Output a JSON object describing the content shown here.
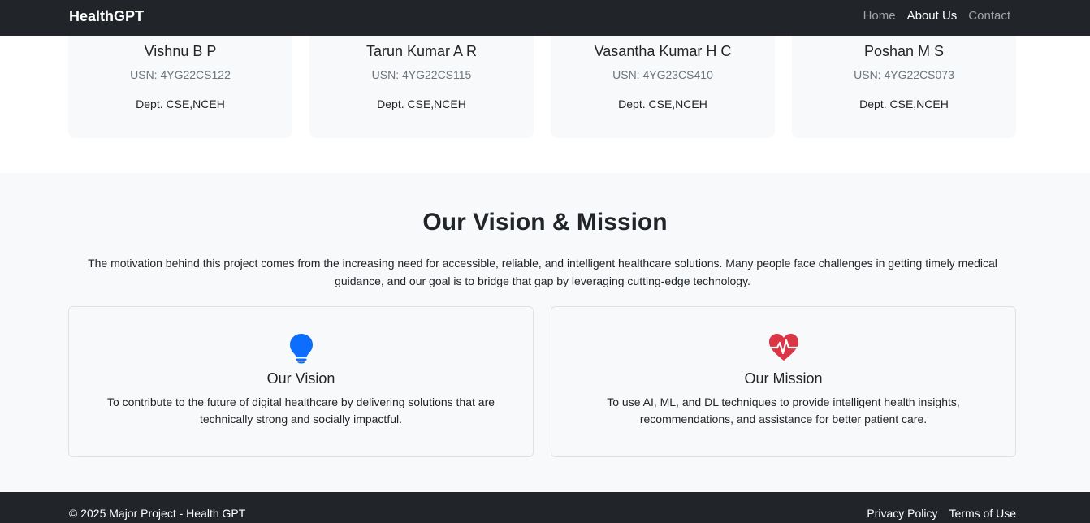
{
  "navbar": {
    "brand": "HealthGPT",
    "links": [
      "Home",
      "About Us",
      "Contact"
    ]
  },
  "team": [
    {
      "name": "Vishnu B P",
      "usn": "USN: 4YG22CS122",
      "dept": "Dept. CSE,NCEH"
    },
    {
      "name": "Tarun Kumar A R",
      "usn": "USN: 4YG22CS115",
      "dept": "Dept. CSE,NCEH"
    },
    {
      "name": "Vasantha Kumar H C",
      "usn": "USN: 4YG23CS410",
      "dept": "Dept. CSE,NCEH"
    },
    {
      "name": "Poshan M S",
      "usn": "USN: 4YG22CS073",
      "dept": "Dept. CSE,NCEH"
    }
  ],
  "vision_section": {
    "title": "Our Vision & Mission",
    "text": "The motivation behind this project comes from the increasing need for accessible, reliable, and intelligent healthcare solutions. Many people face challenges in getting timely medical guidance, and our goal is to bridge that gap by leveraging cutting-edge technology.",
    "cards": [
      {
        "icon": "lightbulb-icon",
        "title": "Our Vision",
        "text": "To contribute to the future of digital healthcare by delivering solutions that are technically strong and socially impactful."
      },
      {
        "icon": "heart-pulse-icon",
        "title": "Our Mission",
        "text": "To use AI, ML, and DL techniques to provide intelligent health insights, recommendations, and assistance for better patient care."
      }
    ]
  },
  "footer": {
    "copyright": "© 2025 Major Project - Health GPT",
    "links": [
      "Privacy Policy",
      "Terms of Use"
    ]
  },
  "colors": {
    "navbar": "#212529",
    "section_bg": "#f8f9fa",
    "vision_icon": "#0d6efd",
    "mission_icon": "#dc3545"
  }
}
